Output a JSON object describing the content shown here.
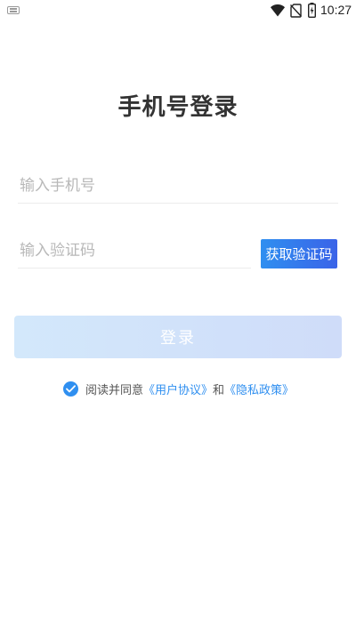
{
  "status_bar": {
    "time": "10:27",
    "icons": [
      "keyboard-icon",
      "wifi-icon",
      "no-sim-icon",
      "battery-icon"
    ]
  },
  "page": {
    "title": "手机号登录"
  },
  "form": {
    "phone_placeholder": "输入手机号",
    "phone_value": "",
    "code_placeholder": "输入验证码",
    "code_value": "",
    "get_code_label": "获取验证码",
    "login_label": "登录"
  },
  "agreement": {
    "checked": true,
    "prefix": "阅读并同意",
    "user_agreement": "《用户协议》",
    "conjunction": "和",
    "privacy_policy": "《隐私政策》"
  },
  "colors": {
    "accent": "#2f8ff0",
    "accent_end": "#3a63e8",
    "login_disabled_start": "#d3e8fb",
    "login_disabled_end": "#cfdcf9",
    "placeholder": "#b8b8b8"
  }
}
